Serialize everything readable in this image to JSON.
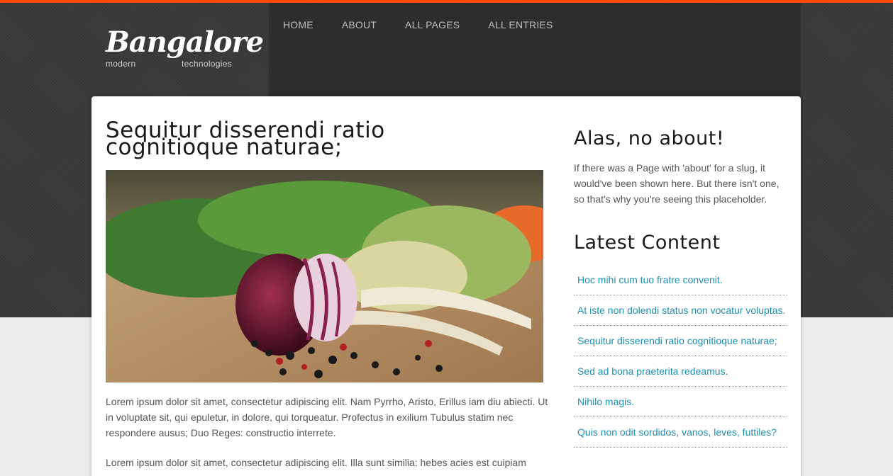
{
  "site": {
    "title": "Bangalore",
    "tagline_left": "modern",
    "tagline_right": "technologies"
  },
  "nav": {
    "items": [
      {
        "label": "HOME"
      },
      {
        "label": "ABOUT"
      },
      {
        "label": "ALL PAGES"
      },
      {
        "label": "ALL ENTRIES"
      }
    ]
  },
  "post": {
    "title": "Sequitur disserendi ratio cognitioque naturae;",
    "paragraphs": [
      "Lorem ipsum dolor sit amet, consectetur adipiscing elit. Nam Pyrrho, Aristo, Erillus iam diu abiecti. Ut in voluptate sit, qui epuletur, in dolore, qui torqueatur. Profectus in exilium Tubulus statim nec respondere ausus; Duo Reges: constructio interrete.",
      "Lorem ipsum dolor sit amet, consectetur adipiscing elit. Illa sunt similia: hebes acies est cuipiam"
    ]
  },
  "sidebar": {
    "about_title": "Alas, no about!",
    "about_text": "If there was a Page with 'about' for a slug, it would've been shown here. But there isn't one, so that's why you're seeing this placeholder.",
    "latest_title": "Latest Content",
    "latest_items": [
      {
        "label": "Hoc mihi cum tuo fratre convenit."
      },
      {
        "label": "At iste non dolendi status non vocatur voluptas."
      },
      {
        "label": "Sequitur disserendi ratio cognitioque naturae;"
      },
      {
        "label": "Sed ad bona praeterita redeamus."
      },
      {
        "label": "Nihilo magis."
      },
      {
        "label": "Quis non odit sordidos, vanos, leves, futtiles?"
      }
    ]
  },
  "colors": {
    "accent_stripe": "#ff4a00",
    "link": "#1e8fb0",
    "header_bg": "#3a3a3a"
  }
}
